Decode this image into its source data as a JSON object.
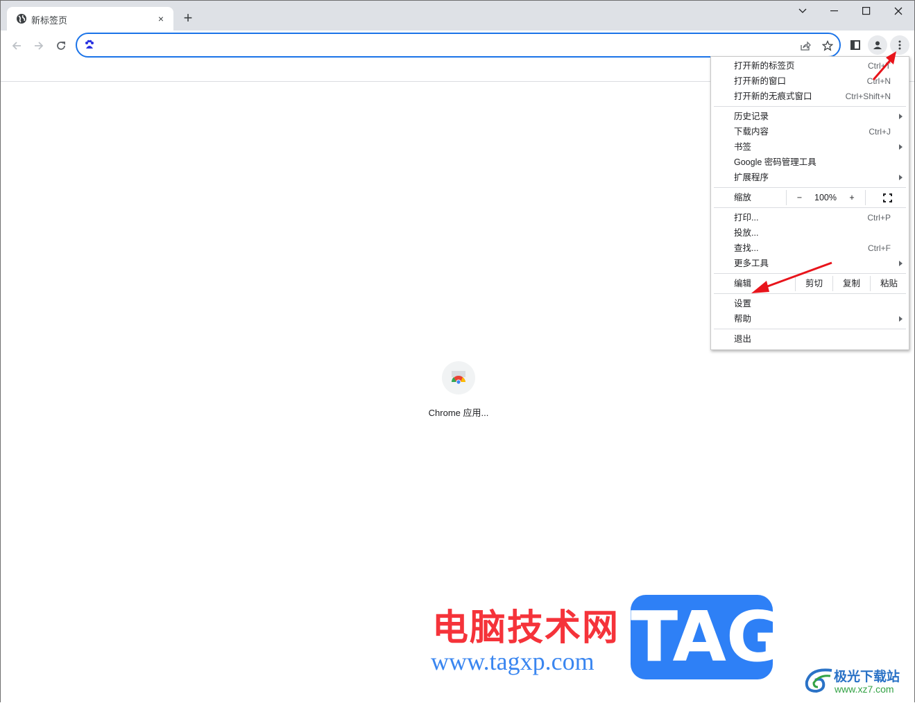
{
  "tab": {
    "title": "新标签页",
    "close_symbol": "×"
  },
  "new_tab_symbol": "+",
  "window_controls": {
    "dropdown": "⌄",
    "minimize": "–",
    "maximize": "□",
    "close": "✕"
  },
  "omnibox": {
    "value": "",
    "placeholder": ""
  },
  "shortcut": {
    "label": "Chrome 应用..."
  },
  "menu": {
    "group1": [
      {
        "label": "打开新的标签页",
        "shortcut": "Ctrl+T"
      },
      {
        "label": "打开新的窗口",
        "shortcut": "Ctrl+N"
      },
      {
        "label": "打开新的无痕式窗口",
        "shortcut": "Ctrl+Shift+N"
      }
    ],
    "group2": [
      {
        "label": "历史记录",
        "submenu": true
      },
      {
        "label": "下载内容",
        "shortcut": "Ctrl+J"
      },
      {
        "label": "书签",
        "submenu": true
      },
      {
        "label": "Google 密码管理工具"
      },
      {
        "label": "扩展程序",
        "submenu": true
      }
    ],
    "zoom": {
      "label": "缩放",
      "minus": "−",
      "value": "100%",
      "plus": "+"
    },
    "group3": [
      {
        "label": "打印...",
        "shortcut": "Ctrl+P"
      },
      {
        "label": "投放..."
      },
      {
        "label": "查找...",
        "shortcut": "Ctrl+F"
      },
      {
        "label": "更多工具",
        "submenu": true
      }
    ],
    "edit": {
      "label": "编辑",
      "cut": "剪切",
      "copy": "复制",
      "paste": "粘贴"
    },
    "group4": [
      {
        "label": "设置"
      },
      {
        "label": "帮助",
        "submenu": true
      }
    ],
    "exit": {
      "label": "退出"
    }
  },
  "watermark": {
    "site_name": "电脑技术网",
    "site_url": "www.tagxp.com",
    "tag_logo": "TAG",
    "xz7_name": "极光下载站",
    "xz7_url": "www.xz7.com"
  },
  "colors": {
    "accent": "#1a73e8",
    "annotation_arrow": "#e8141b",
    "titlebar": "#dee1e6"
  }
}
